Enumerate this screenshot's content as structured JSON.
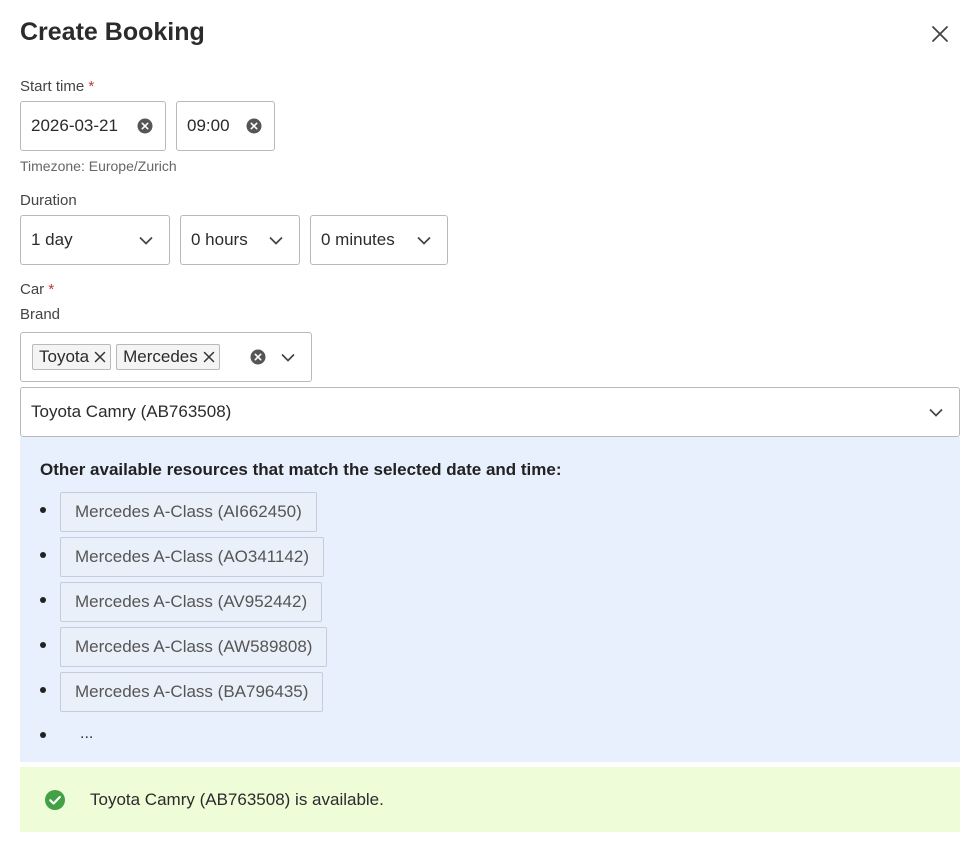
{
  "dialog": {
    "title": "Create Booking"
  },
  "start_time": {
    "label": "Start time",
    "required_mark": "*",
    "date_value": "2026-03-21",
    "time_value": "09:00",
    "timezone_hint": "Timezone: Europe/Zurich"
  },
  "duration": {
    "label": "Duration",
    "days": "1 day",
    "hours": "0 hours",
    "minutes": "0 minutes"
  },
  "car": {
    "label": "Car",
    "required_mark": "*",
    "brand_label": "Brand",
    "brand_chips": [
      "Toyota",
      "Mercedes"
    ],
    "selected_car": "Toyota Camry (AB763508)"
  },
  "alternatives": {
    "heading": "Other available resources that match the selected date and time:",
    "items": [
      "Mercedes A-Class (AI662450)",
      "Mercedes A-Class (AO341142)",
      "Mercedes A-Class (AV952442)",
      "Mercedes A-Class (AW589808)",
      "Mercedes A-Class (BA796435)"
    ],
    "more": "..."
  },
  "availability": {
    "message": "Toyota Camry (AB763508) is available.",
    "color": "#43a047"
  },
  "icons": {
    "close": "close-icon",
    "clear": "clear-circle-icon",
    "chevron": "chevron-down-icon",
    "check": "check-circle-icon"
  }
}
